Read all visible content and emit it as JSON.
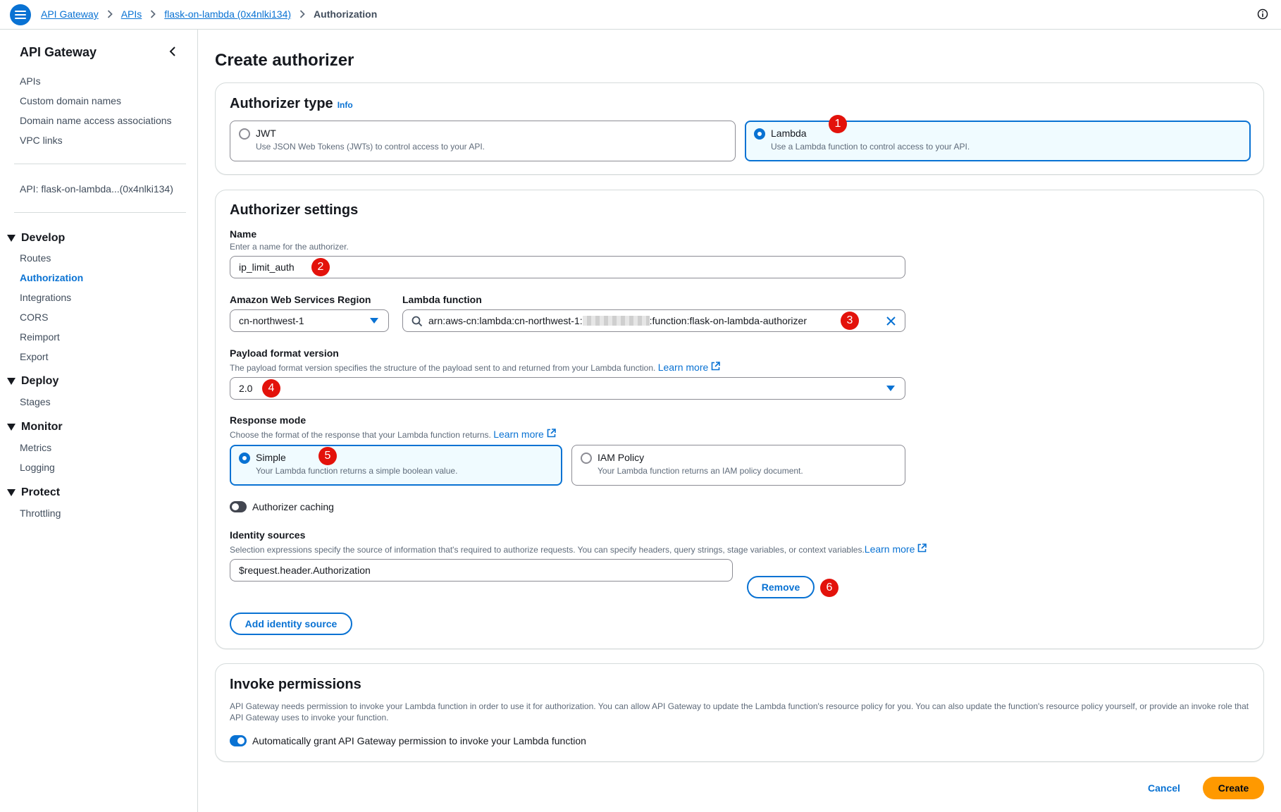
{
  "breadcrumb": [
    "API Gateway",
    "APIs",
    "flask-on-lambda (0x4nlki134)",
    "Authorization"
  ],
  "sidebar": {
    "title": "API Gateway",
    "top_links": [
      "APIs",
      "Custom domain names",
      "Domain name access associations",
      "VPC links"
    ],
    "api_label": "API: flask-on-lambda...(0x4nlki134)",
    "develop": {
      "title": "Develop",
      "items": [
        "Routes",
        "Authorization",
        "Integrations",
        "CORS",
        "Reimport",
        "Export"
      ],
      "active": "Authorization"
    },
    "deploy": {
      "title": "Deploy",
      "items": [
        "Stages"
      ]
    },
    "monitor": {
      "title": "Monitor",
      "items": [
        "Metrics",
        "Logging"
      ]
    },
    "protect": {
      "title": "Protect",
      "items": [
        "Throttling"
      ]
    }
  },
  "page_title": "Create authorizer",
  "authorizer_type": {
    "heading": "Authorizer type",
    "info": "Info",
    "options": [
      {
        "title": "JWT",
        "desc": "Use JSON Web Tokens (JWTs) to control access to your API.",
        "selected": false
      },
      {
        "title": "Lambda",
        "desc": "Use a Lambda function to control access to your API.",
        "selected": true
      }
    ]
  },
  "settings": {
    "heading": "Authorizer settings",
    "name": {
      "label": "Name",
      "desc": "Enter a name for the authorizer.",
      "value": "ip_limit_auth"
    },
    "region": {
      "label": "Amazon Web Services Region",
      "value": "cn-northwest-1"
    },
    "lambda": {
      "label": "Lambda function",
      "value_prefix": "arn:aws-cn:lambda:cn-northwest-1:",
      "value_suffix": ":function:flask-on-lambda-authorizer"
    },
    "payload": {
      "label": "Payload format version",
      "desc": "The payload format version specifies the structure of the payload sent to and returned from your Lambda function.",
      "learn_more": "Learn more",
      "value": "2.0"
    },
    "response_mode": {
      "label": "Response mode",
      "desc": "Choose the format of the response that your Lambda function returns.",
      "learn_more": "Learn more",
      "options": [
        {
          "title": "Simple",
          "desc": "Your Lambda function returns a simple boolean value.",
          "selected": true
        },
        {
          "title": "IAM Policy",
          "desc": "Your Lambda function returns an IAM policy document.",
          "selected": false
        }
      ]
    },
    "caching": {
      "label": "Authorizer caching",
      "enabled": false
    },
    "identity": {
      "label": "Identity sources",
      "desc": "Selection expressions specify the source of information that's required to authorize requests. You can specify headers, query strings, stage variables, or context variables.",
      "learn_more": "Learn more",
      "value": "$request.header.Authorization",
      "remove_label": "Remove",
      "add_label": "Add identity source"
    }
  },
  "permissions": {
    "heading": "Invoke permissions",
    "desc": "API Gateway needs permission to invoke your Lambda function in order to use it for authorization. You can allow API Gateway to update the Lambda function's resource policy for you. You can also update the function's resource policy yourself, or provide an invoke role that API Gateway uses to invoke your function.",
    "toggle_label": "Automatically grant API Gateway permission to invoke your Lambda function",
    "enabled": true
  },
  "actions": {
    "cancel": "Cancel",
    "create": "Create"
  },
  "annotations": [
    "1",
    "2",
    "3",
    "4",
    "5",
    "6"
  ],
  "colors": {
    "accent": "#0972d3",
    "primary_button": "#ff9900",
    "annotation": "#e3120b"
  }
}
